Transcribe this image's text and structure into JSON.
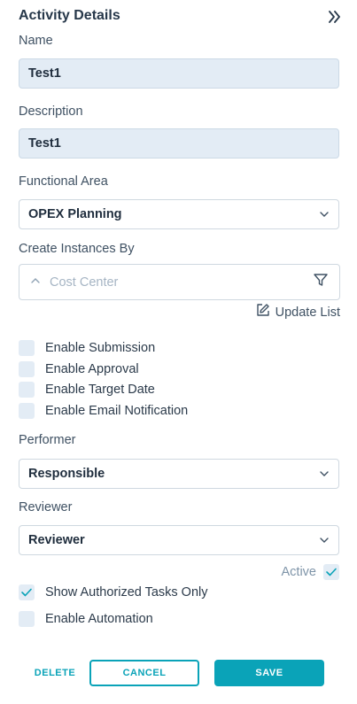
{
  "header": {
    "title": "Activity Details",
    "collapse_icon": "double-chevron-right-icon"
  },
  "name": {
    "label": "Name",
    "value": "Test1"
  },
  "description": {
    "label": "Description",
    "value": "Test1"
  },
  "functional_area": {
    "label": "Functional Area",
    "value": "OPEX Planning"
  },
  "create_instances": {
    "label": "Create Instances By",
    "placeholder": "Cost Center",
    "update_list": "Update List"
  },
  "checkboxes": [
    {
      "label": "Enable Submission",
      "checked": false
    },
    {
      "label": "Enable Approval",
      "checked": false
    },
    {
      "label": "Enable Target Date",
      "checked": false
    },
    {
      "label": "Enable Email Notification",
      "checked": false
    }
  ],
  "performer": {
    "label": "Performer",
    "value": "Responsible"
  },
  "reviewer": {
    "label": "Reviewer",
    "value": "Reviewer"
  },
  "active": {
    "label": "Active",
    "checked": true
  },
  "show_authorized": {
    "label": "Show Authorized Tasks Only",
    "checked": true
  },
  "enable_automation": {
    "label": "Enable Automation",
    "checked": false
  },
  "buttons": {
    "delete": "DELETE",
    "cancel": "CANCEL",
    "save": "SAVE"
  },
  "colors": {
    "accent": "#0aa3b8",
    "field_bg": "#e3ecf5",
    "label": "#3f5163"
  }
}
